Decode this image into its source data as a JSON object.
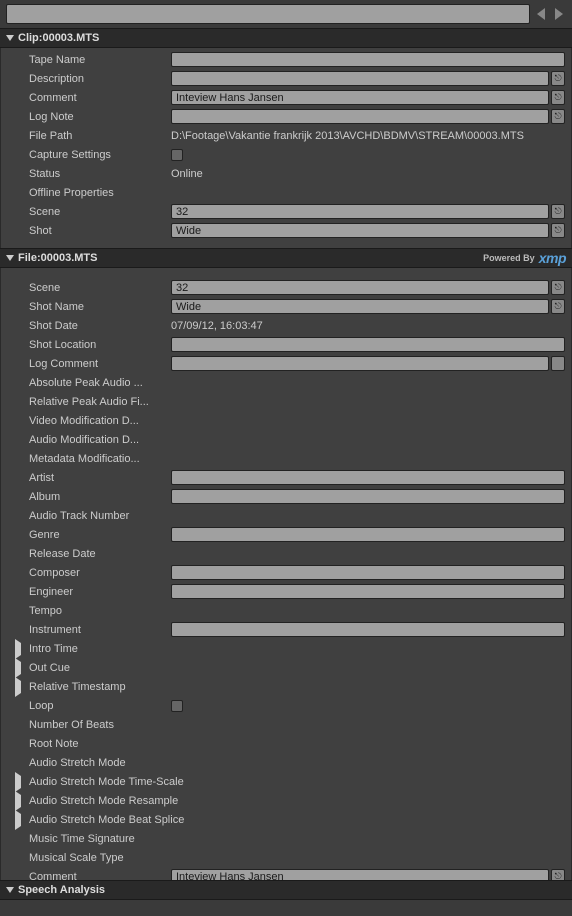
{
  "search": {
    "placeholder": ""
  },
  "sections": {
    "clip": {
      "prefix": "Clip: ",
      "name": "00003.MTS"
    },
    "file": {
      "prefix": "File: ",
      "name": "00003.MTS",
      "powered": "Powered By",
      "xmp": "xmp"
    },
    "speech": {
      "title": "Speech Analysis"
    }
  },
  "clip": {
    "tape_name": {
      "label": "Tape Name",
      "value": ""
    },
    "description": {
      "label": "Description",
      "value": ""
    },
    "comment": {
      "label": "Comment",
      "value": "Inteview Hans Jansen"
    },
    "log_note": {
      "label": "Log Note",
      "value": ""
    },
    "file_path": {
      "label": "File Path",
      "value": "D:\\Footage\\Vakantie frankrijk 2013\\AVCHD\\BDMV\\STREAM\\00003.MTS"
    },
    "capture_settings": {
      "label": "Capture Settings"
    },
    "status": {
      "label": "Status",
      "value": "Online"
    },
    "offline_properties": {
      "label": "Offline Properties",
      "value": ""
    },
    "scene": {
      "label": "Scene",
      "value": "32"
    },
    "shot": {
      "label": "Shot",
      "value": "Wide"
    }
  },
  "file": {
    "scene": {
      "label": "Scene",
      "value": "32"
    },
    "shot_name": {
      "label": "Shot Name",
      "value": "Wide"
    },
    "shot_date": {
      "label": "Shot Date",
      "value": "07/09/12, 16:03:47"
    },
    "shot_location": {
      "label": "Shot Location",
      "value": ""
    },
    "log_comment": {
      "label": "Log Comment",
      "value": ""
    },
    "abs_peak": {
      "label": "Absolute Peak Audio ..."
    },
    "rel_peak": {
      "label": "Relative Peak Audio Fi..."
    },
    "video_mod": {
      "label": "Video Modification D..."
    },
    "audio_mod": {
      "label": "Audio Modification D..."
    },
    "meta_mod": {
      "label": "Metadata Modificatio..."
    },
    "artist": {
      "label": "Artist",
      "value": ""
    },
    "album": {
      "label": "Album",
      "value": ""
    },
    "track_num": {
      "label": "Audio Track Number"
    },
    "genre": {
      "label": "Genre",
      "value": ""
    },
    "release_date": {
      "label": "Release Date"
    },
    "composer": {
      "label": "Composer",
      "value": ""
    },
    "engineer": {
      "label": "Engineer",
      "value": ""
    },
    "tempo": {
      "label": "Tempo"
    },
    "instrument": {
      "label": "Instrument",
      "value": ""
    },
    "intro_time": {
      "label": "Intro Time"
    },
    "out_cue": {
      "label": "Out Cue"
    },
    "rel_timestamp": {
      "label": "Relative Timestamp"
    },
    "loop": {
      "label": "Loop"
    },
    "num_beats": {
      "label": "Number Of Beats"
    },
    "root_note": {
      "label": "Root Note"
    },
    "stretch_mode": {
      "label": "Audio Stretch Mode"
    },
    "stretch_time": {
      "label": "Audio Stretch Mode Time-Scale"
    },
    "stretch_resample": {
      "label": "Audio Stretch Mode Resample"
    },
    "stretch_beat": {
      "label": "Audio Stretch Mode Beat Splice"
    },
    "time_sig": {
      "label": "Music Time Signature"
    },
    "scale_type": {
      "label": "Musical Scale Type"
    },
    "comment": {
      "label": "Comment",
      "value": "Inteview Hans Jansen"
    }
  }
}
